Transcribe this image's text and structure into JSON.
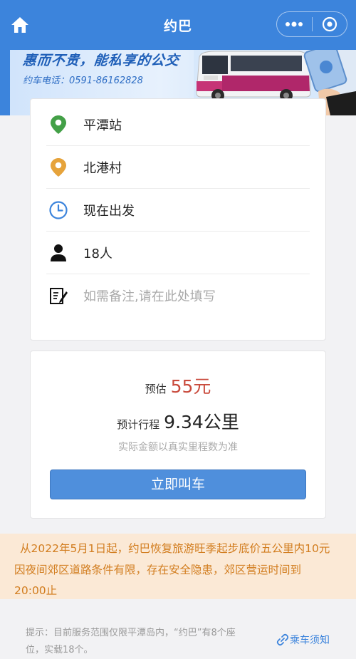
{
  "navbar": {
    "title": "约巴",
    "home_icon": "home-icon",
    "more_icon": "more-dots-icon",
    "close_icon": "target-circle-icon",
    "bg_color": "#3c84dc"
  },
  "banner": {
    "slogan": "惠而不贵，能私享的公交",
    "phone": "约车电话：0591-86162828"
  },
  "trip": {
    "origin": "平潭站",
    "destination": "北港村",
    "time": "现在出发",
    "passengers": "18人",
    "remark_placeholder": "如需备注,请在此处填写"
  },
  "estimate": {
    "price_label": "预估",
    "price_value": "55元",
    "distance_label": "预计行程",
    "distance_value": "9.34公里",
    "note": "实际金额以真实里程数为准",
    "call_button": "立即叫车",
    "price_color": "#c94a3c"
  },
  "notice": {
    "line1": "从2022年5月1日起，约巴恢复旅游旺季起步底价五公里内10元",
    "line2": "因夜间郊区道路条件有限，存在安全隐患，郊区营运时间到",
    "line3": "20:00止"
  },
  "footer": {
    "tip_line1": "提示：目前服务范围仅限平潭岛内，“约巴”有8个座",
    "tip_line2": "位，实载18个。",
    "rules_link": "乘车须知"
  }
}
